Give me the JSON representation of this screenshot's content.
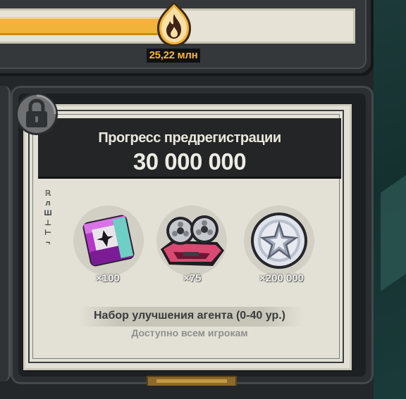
{
  "progress_bar": {
    "value_label": "25,22 млн",
    "fill_fraction": 0.46,
    "icon": "flame-icon"
  },
  "card": {
    "title": "Прогресс предрегистрации",
    "milestone": "30 000 000",
    "locked_icon": "lock-icon",
    "side_glyphs": [
      "ℝ",
      "л",
      "Ш",
      "⊥",
      "⊢",
      "¬"
    ],
    "rewards": [
      {
        "name": "agent-upgrade-box",
        "quantity": "×100",
        "icon": "purple-box-icon"
      },
      {
        "name": "film-reel-device",
        "quantity": "×75",
        "icon": "film-reel-icon"
      },
      {
        "name": "silver-coin",
        "quantity": "×200 000",
        "icon": "star-coin-icon"
      }
    ],
    "package_name": "Набор улучшения агента (0-40 ур.)",
    "availability": "Доступно всем игрокам"
  },
  "colors": {
    "progress_fill": "#f2b33a",
    "value_text": "#f3b640",
    "header_band": "#232526",
    "paper": "#e3e1d6"
  }
}
